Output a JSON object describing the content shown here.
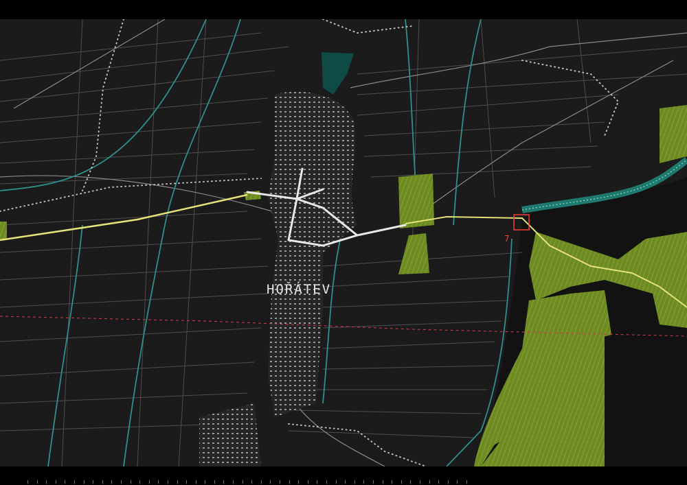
{
  "map": {
    "place_label": "HOŘÁTEV",
    "marker_label": "7",
    "colors": {
      "background": "#1b1b1b",
      "field_lines": "#5a5a5a",
      "road_main": "#e8e8e8",
      "road_secondary": "#9a9a9a",
      "waterway": "#2f8f8a",
      "pond": "#0f4a46",
      "highlight_route": "#e6e27a",
      "green_area": "#7f9a2a",
      "boundary_dashed": "#d23a4a",
      "marker": "#ff3b3b",
      "river_band": "#1e7a6e"
    },
    "icons": [
      "route-marker-icon"
    ]
  }
}
